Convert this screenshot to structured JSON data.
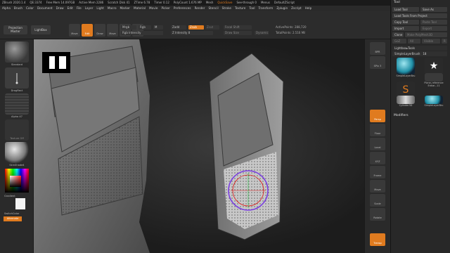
{
  "titlebar": {
    "app": "ZBrush 2020.1.4",
    "stats": [
      "QE:3374",
      "Free Mem 14.097GB",
      "Active Mem 2286",
      "Scratch Disk 41",
      "ZTime 6.78",
      "Timer 0.12",
      "PolyCount 1.676 MP",
      "Mesh"
    ],
    "quicksave": "QuickSave",
    "see_through": "See-through 0",
    "menus_label": "Menus",
    "script": "DefaultZScript"
  },
  "menubar": [
    "Alpha",
    "Brush",
    "Color",
    "Document",
    "Draw",
    "Edit",
    "File",
    "Layer",
    "Light",
    "Macro",
    "Marker",
    "Material",
    "Movie",
    "Picker",
    "Preferences",
    "Render",
    "Stencil",
    "Stroke",
    "Texture",
    "Tool",
    "Transform",
    "Zplugin",
    "Zscript",
    "Help"
  ],
  "toolbar": {
    "projection_master": "Projection Master",
    "lightbox": "LightBox",
    "tools": [
      {
        "label": "Move",
        "active": false
      },
      {
        "label": "Edit",
        "active": true
      },
      {
        "label": "Draw",
        "active": false
      },
      {
        "label": "Move",
        "active": false
      },
      {
        "label": "Scale",
        "active": false
      },
      {
        "label": "Rotate",
        "active": false
      }
    ],
    "mrgb": "Mrgb",
    "rgb": "Rgb",
    "m": "M",
    "zadd": "Zadd",
    "zsub": "Zsub",
    "zcut": "Zcut",
    "rgb_intensity": "Rgb Intensity",
    "z_intensity": "Z Intensity 8",
    "focal_shift": "Focal Shift",
    "draw_size": "Draw Size",
    "dynamic": "Dynamic",
    "active_points": "ActivePoints: 288,720",
    "total_points": "TotalPoints: 2.516 Mil"
  },
  "left_shelf": {
    "brush_label": "Standard",
    "stroke_label": "DragRect",
    "alpha_label": "Alpha 47",
    "texture_label": "Texture Off",
    "material_label": "SkinShade4",
    "gradient_label": "Gradient",
    "switch_color": "SwitchColor",
    "alternate": "Alternate"
  },
  "right_shelf": [
    "BPR",
    "SPix 3",
    "Persp",
    "Floor",
    "Local",
    "XYZ",
    "Frame",
    "Move",
    "Scale",
    "Rotate",
    "Transp",
    "Ghost",
    "Solo",
    "Xpose"
  ],
  "tray": {
    "title": "Tool",
    "buttons": [
      {
        "label": "Load Tool",
        "dim": false
      },
      {
        "label": "Save As",
        "dim": false
      },
      {
        "label": "Load Tools From Project",
        "dim": false
      },
      {
        "label": "Copy Tool",
        "dim": false
      },
      {
        "label": "Paste Tool",
        "dim": true
      },
      {
        "label": "Import",
        "dim": false
      },
      {
        "label": "Export",
        "dim": true
      },
      {
        "label": "Clone",
        "dim": false
      },
      {
        "label": "Make PolyMesh3D",
        "dim": true
      },
      {
        "label": "GoZ",
        "dim": true
      },
      {
        "label": "All",
        "dim": true
      },
      {
        "label": "Visible",
        "dim": true
      },
      {
        "label": "R",
        "dim": true
      }
    ],
    "lightbox_tools": "Lightbox▸Tools",
    "current_tool": "SimpleLayerBrush",
    "current_count": "18",
    "tool_items": [
      "SimpleLayerBru",
      "PolyMesh3D",
      "SimpleBrush",
      "Plane_reference",
      "Cylinder3D",
      "SimpleLayerBru",
      "Erase...11"
    ],
    "modifiers": "Modifiers"
  },
  "colors": {
    "accent": "#e07b1f"
  }
}
